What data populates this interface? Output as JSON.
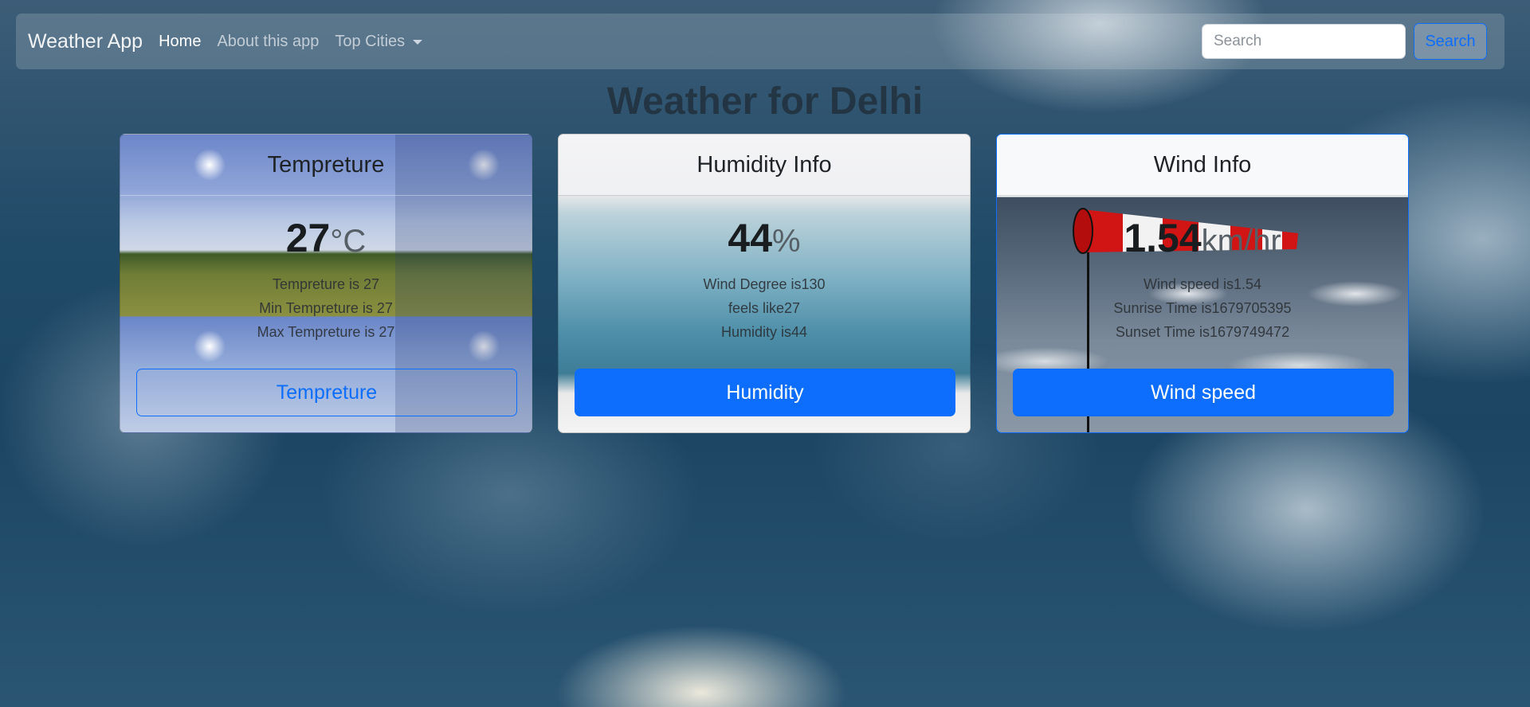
{
  "navbar": {
    "brand": "Weather App",
    "links": [
      {
        "label": "Home",
        "active": true
      },
      {
        "label": "About this app",
        "active": false
      },
      {
        "label": "Top Cities",
        "active": false,
        "dropdown": true
      }
    ],
    "search_placeholder": "Search",
    "search_button": "Search"
  },
  "heading": "Weather for Delhi",
  "cards": {
    "temperature": {
      "title": "Tempreture",
      "value": "27",
      "unit": "°C",
      "lines": [
        "Tempreture is 27",
        "Min Tempreture is 27",
        "Max Tempreture is 27"
      ],
      "button": "Tempreture"
    },
    "humidity": {
      "title": "Humidity Info",
      "value": "44",
      "unit": "%",
      "lines": [
        "Wind Degree is130",
        "feels like27",
        "Humidity is44"
      ],
      "button": "Humidity"
    },
    "wind": {
      "title": "Wind Info",
      "value": "1.54",
      "unit": "km/hr",
      "lines": [
        "Wind speed is1.54",
        "Sunrise Time is1679705395",
        "Sunset Time is1679749472"
      ],
      "button": "Wind speed"
    }
  },
  "colors": {
    "primary": "#0d6efd",
    "heading": "#1f2a33"
  }
}
